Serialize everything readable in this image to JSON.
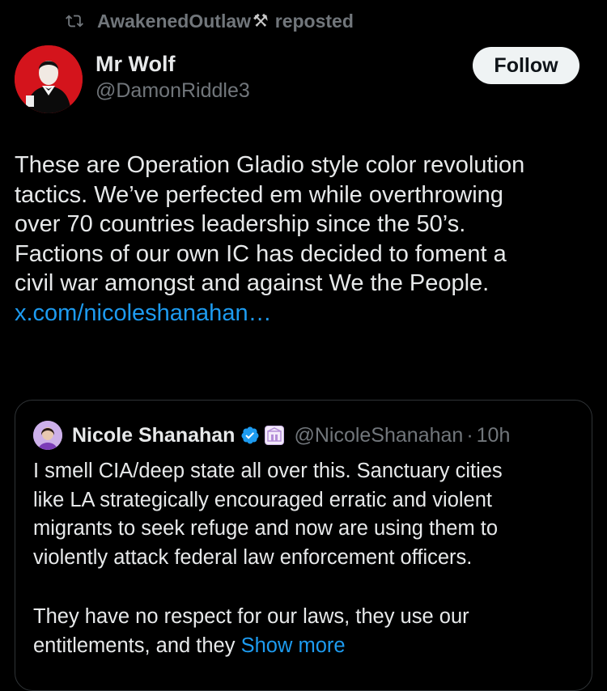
{
  "repost": {
    "user": "AwakenedOutlaw",
    "emoji": "⚒",
    "label": "reposted",
    "icon": "repost-icon"
  },
  "author": {
    "name": "Mr Wolf",
    "handle": "@DamonRiddle3",
    "avatar_icon": "avatar-image"
  },
  "follow_button": {
    "label": "Follow"
  },
  "tweet": {
    "lines": [
      "These are Operation Gladio style color revolution",
      "tactics. We’ve perfected em while overthrowing",
      "over 70 countries leadership since the 50’s.",
      "Factions of our own IC has decided to foment a",
      "civil war amongst and against We the People."
    ],
    "link": "x.com/nicoleshanahan…"
  },
  "quote": {
    "name": "Nicole Shanahan",
    "handle": "@NicoleShanahan",
    "separator": "·",
    "time": "10h",
    "verified_icon": "verified-badge-icon",
    "affiliation_icon": "affiliation-badge-icon",
    "lines": [
      "I smell CIA/deep state all over this. Sanctuary cities",
      "like LA strategically encouraged erratic and violent",
      "migrants to seek refuge and now are using them to",
      "violently attack federal law enforcement officers."
    ],
    "lines2": [
      "They have no respect for our laws, they use our"
    ],
    "last_line": "entitlements, and they",
    "show_more": "Show more"
  },
  "colors": {
    "background": "#000000",
    "text": "#e7e9ea",
    "secondary": "#71767b",
    "link": "#1d9bf0",
    "border": "#2f3336"
  }
}
